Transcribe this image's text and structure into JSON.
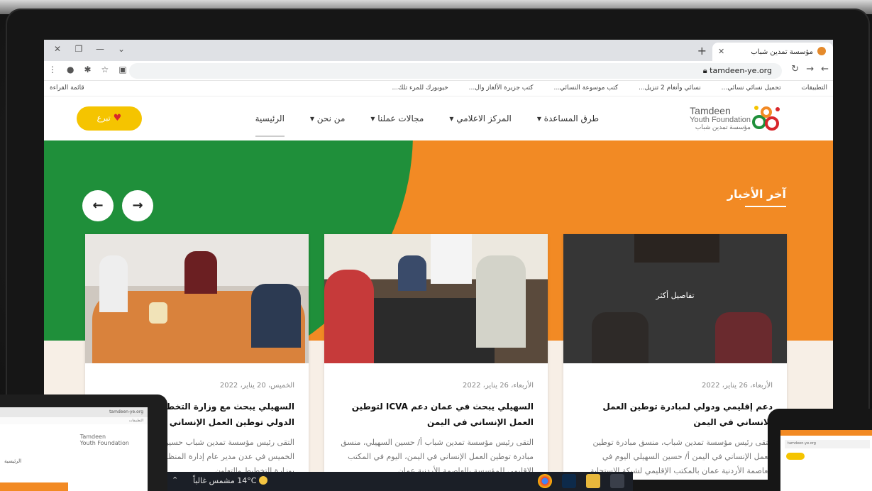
{
  "browser": {
    "tab_title": "مؤسسة تمدين شباب",
    "url": "tamdeen-ye.org",
    "bookmarks": [
      "التطبيقات",
      "تحميل نسائي نسائي...",
      "نسائي وأنغام 2 تنزيل...",
      "كتب موسوعة النسائي...",
      "كتب جزيرة الألغاز وال...",
      "خيوبورك للمرء تلك..."
    ],
    "reading_list": "قائمة القراءة"
  },
  "site": {
    "logo": {
      "line1": "Tamdeen",
      "line2": "Youth Foundation",
      "line3": "مؤسسة تمدين شباب"
    },
    "nav": [
      "الرئيسية",
      "من نحن ▾",
      "مجالات عملنا ▾",
      "المركز الاعلامي ▾",
      "طرق المساعدة ▾"
    ],
    "donate_label": "تبرع"
  },
  "news": {
    "section_title": "آخر الأخبار",
    "hover_label": "تفاصيل أكثر",
    "cards": [
      {
        "date": "الأربعاء، 26 يناير، 2022",
        "title": "دعم إقليمي ودولي لمبادرة توطين العمل الانساني في اليمن",
        "excerpt": "التقى رئيس مؤسسة تمدين شباب، منسق مبادرة توطين العمل الإنساني في اليمن أ/ حسين السهيلي اليوم في العاصمة الأردنية عمان بالمكتب الإقليمي لشبكة الاستجابة"
      },
      {
        "date": "الأربعاء، 26 يناير، 2022",
        "title": "السهيلي يبحث في عمان دعم ICVA لتوطين العمل الإنساني في اليمن",
        "excerpt": "التقى رئيس مؤسسة تمدين شباب أ/ حسين السهيلي، منسق مبادرة توطين العمل الإنساني في اليمن، اليوم في المكتب الاقليمي للمؤسسة بالعاصمة الأردنية عمان"
      },
      {
        "date": "الخميس، 20 يناير، 2022",
        "title": "السهيلي يبحث مع وزارة التخطيط والتعاون الدولي توطين العمل الإنساني وبرنامج التعاون",
        "excerpt": "التقى رئيس مؤسسة تمدين شباب حسين السهيلي، اليوم الخميس في عدن مدير عام إدارة المنظمات الإقليمية والدولية بوزارة التخطيط والتعاون"
      }
    ]
  },
  "taskbar": {
    "weather_temp": "14°C",
    "weather_text": "مشمس غالباً"
  },
  "colors": {
    "orange": "#f28a24",
    "green": "#1f8f3a",
    "yellow": "#f5c400"
  }
}
